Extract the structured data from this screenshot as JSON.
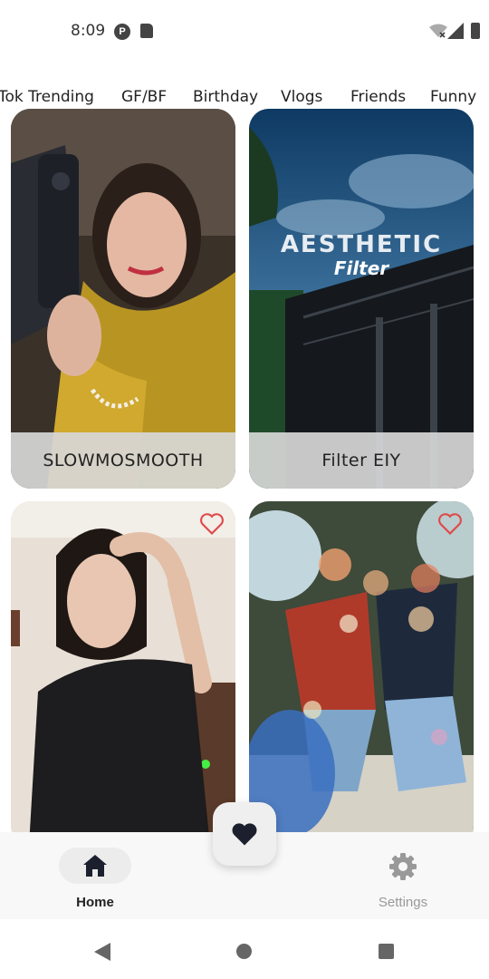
{
  "status_bar": {
    "time": "8:09",
    "icons": [
      "p-app-icon",
      "sd-card-icon",
      "wifi-icon",
      "signal-icon",
      "battery-icon"
    ]
  },
  "tabs": [
    "Tok Trending",
    "GF/BF",
    "Birthday",
    "Vlogs",
    "Friends",
    "Funny"
  ],
  "cards": [
    {
      "label": "SLOWMOSMOOTH",
      "thumbnail": "selfie-woman-yellow-scarf"
    },
    {
      "label": "Filter EIY",
      "thumbnail": "aesthetic-filter-building",
      "overlay_title": "AESTHETIC",
      "overlay_subtitle": "Filter"
    },
    {
      "label": "",
      "thumbnail": "woman-black-shirt",
      "favorite_icon": "heart-outline-icon"
    },
    {
      "label": "",
      "thumbnail": "dancing-people-bokeh",
      "favorite_icon": "heart-outline-icon"
    }
  ],
  "bottom_nav": {
    "home_label": "Home",
    "settings_label": "Settings",
    "fab_icon": "heart-icon"
  },
  "colors": {
    "accent_heart": "#e04848",
    "nav_active": "#222222",
    "nav_inactive": "#999999"
  }
}
